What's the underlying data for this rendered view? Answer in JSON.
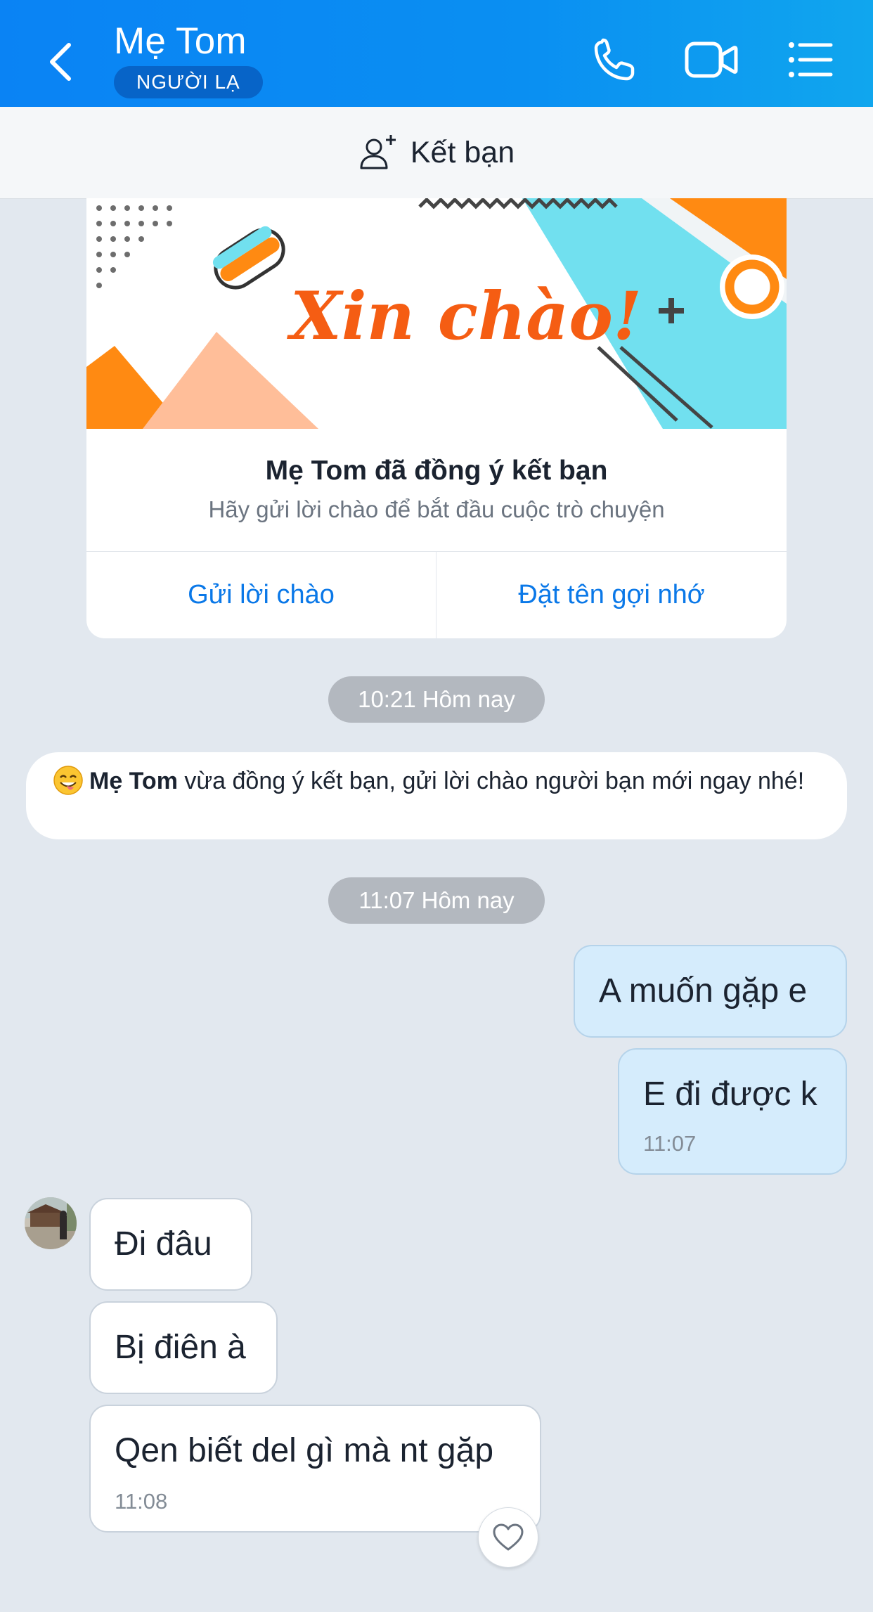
{
  "header": {
    "contact_name": "Mẹ Tom",
    "badge": "NGƯỜI LẠ",
    "icons": [
      "back-icon",
      "phone-icon",
      "video-call-icon",
      "menu-list-icon"
    ]
  },
  "add_friend": {
    "label": "Kết bạn",
    "icon": "add-person-icon"
  },
  "greeting_card": {
    "banner_text": "Xin chào!",
    "title": "Mẹ Tom đã đồng ý kết bạn",
    "subtitle": "Hãy gửi lời chào để bắt đầu cuộc trò chuyện",
    "send_greeting_label": "Gửi lời chào",
    "set_nickname_label": "Đặt tên gợi nhớ"
  },
  "timeline": {
    "time1": "10:21 Hôm nay",
    "time2": "11:07 Hôm nay"
  },
  "system_message": {
    "name": "Mẹ Tom",
    "text": " vừa đồng ý kết bạn, gửi lời chào người bạn mới ngay nhé!"
  },
  "messages": {
    "out1": {
      "text": "A muốn gặp e"
    },
    "out2": {
      "text": "E đi được k",
      "time": "11:07"
    },
    "in1": {
      "text": "Đi đâu"
    },
    "in2": {
      "text": "Bị điên à"
    },
    "in3": {
      "text": "Qen biết del gì mà nt gặp",
      "time": "11:08"
    }
  },
  "colors": {
    "header_blue": "#0a83f4",
    "badge_blue": "#0764c8",
    "link_blue": "#0a78e8",
    "outgoing_bubble": "#d5ecfc",
    "chat_background": "#e2e8ef",
    "banner_orange": "#f55d13"
  }
}
